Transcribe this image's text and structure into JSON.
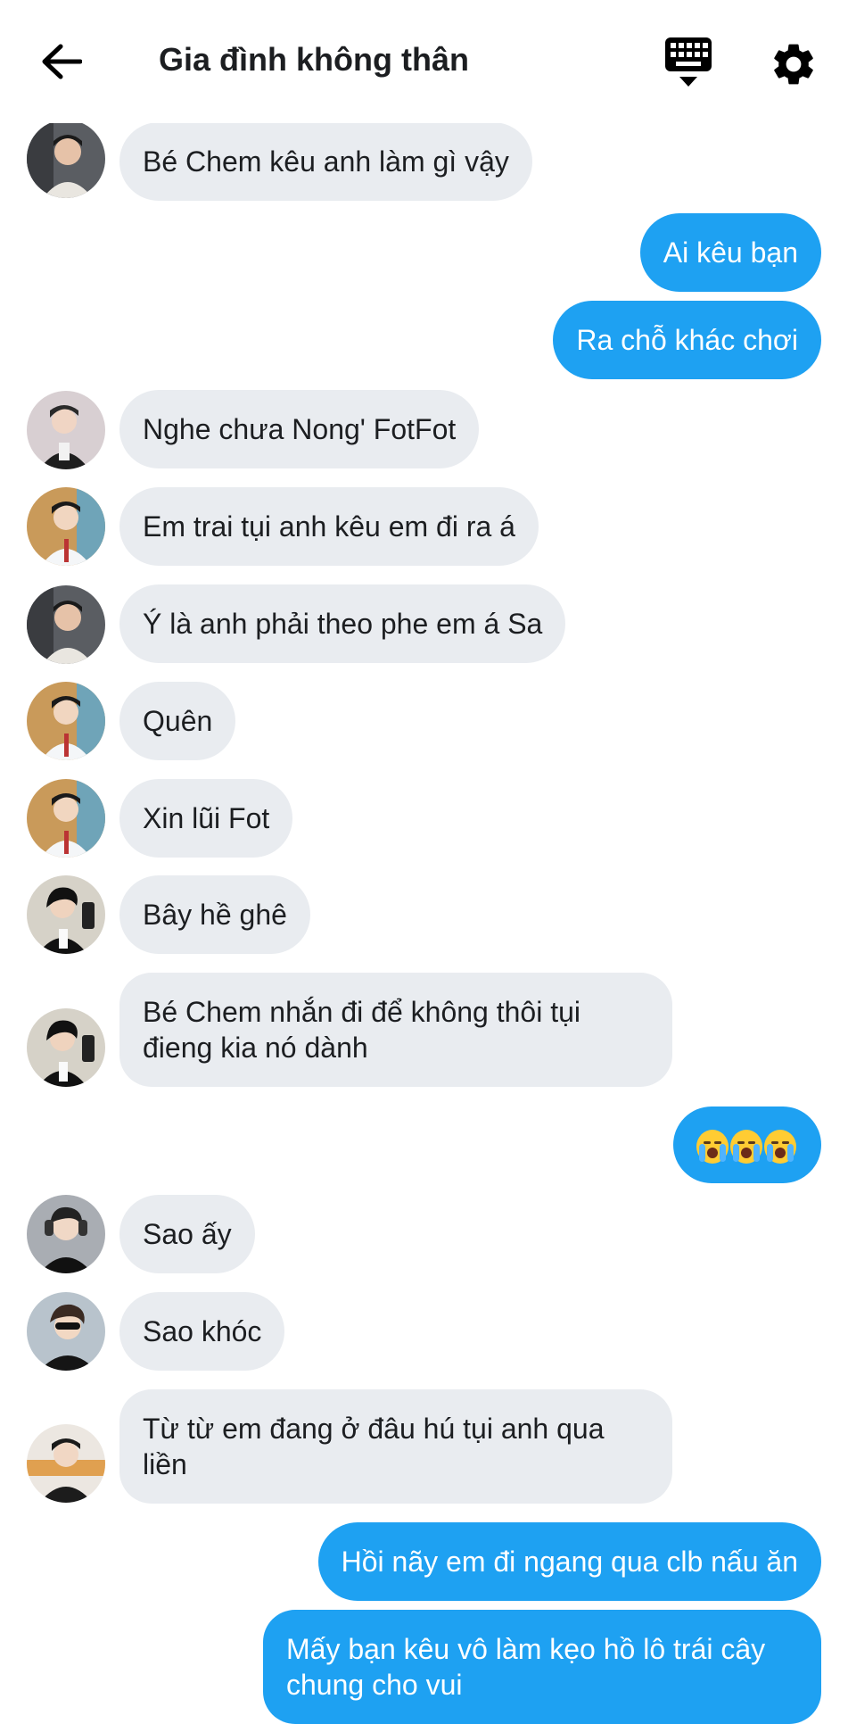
{
  "header": {
    "title": "Gia đình không thân",
    "back_icon": "arrow-left-icon",
    "keyboard_icon": "keyboard-icon",
    "settings_icon": "gear-icon"
  },
  "colors": {
    "incoming_bubble": "#e9ecf0",
    "outgoing_bubble": "#1ea1f2",
    "background": "#ffffff"
  },
  "messages": [
    {
      "side": "in",
      "text": "Bé Chem kêu anh làm gì vậy",
      "avatar": "avatar-a"
    },
    {
      "side": "out",
      "text": "Ai kêu bạn"
    },
    {
      "side": "out",
      "text": "Ra chỗ khác chơi"
    },
    {
      "side": "in",
      "text": "Nghe chưa Nong' FotFot",
      "avatar": "avatar-b"
    },
    {
      "side": "in",
      "text": "Em trai tụi anh kêu em đi ra á",
      "avatar": "avatar-c"
    },
    {
      "side": "in",
      "text": "Ý là anh phải theo phe em á Sa",
      "avatar": "avatar-a"
    },
    {
      "side": "in",
      "text": "Quên",
      "avatar": "avatar-c"
    },
    {
      "side": "in",
      "text": "Xin lũi Fot",
      "avatar": "avatar-c"
    },
    {
      "side": "in",
      "text": "Bây hề ghê",
      "avatar": "avatar-d"
    },
    {
      "side": "in",
      "text": "Bé Chem nhắn đi để không thôi tụi đieng kia nó dành",
      "avatar": "avatar-d"
    },
    {
      "side": "out",
      "text": "",
      "emoji": [
        "loudly-crying-face",
        "loudly-crying-face",
        "loudly-crying-face"
      ]
    },
    {
      "side": "in",
      "text": "Sao ấy",
      "avatar": "avatar-e"
    },
    {
      "side": "in",
      "text": "Sao khóc",
      "avatar": "avatar-f"
    },
    {
      "side": "in",
      "text": "Từ từ em đang ở đâu hú tụi anh qua liền",
      "avatar": "avatar-g"
    },
    {
      "side": "out",
      "text": "Hồi nãy em đi ngang qua clb nấu ăn"
    },
    {
      "side": "out",
      "text": "Mấy bạn kêu vô làm kẹo hồ lô trái cây chung cho vui"
    }
  ]
}
